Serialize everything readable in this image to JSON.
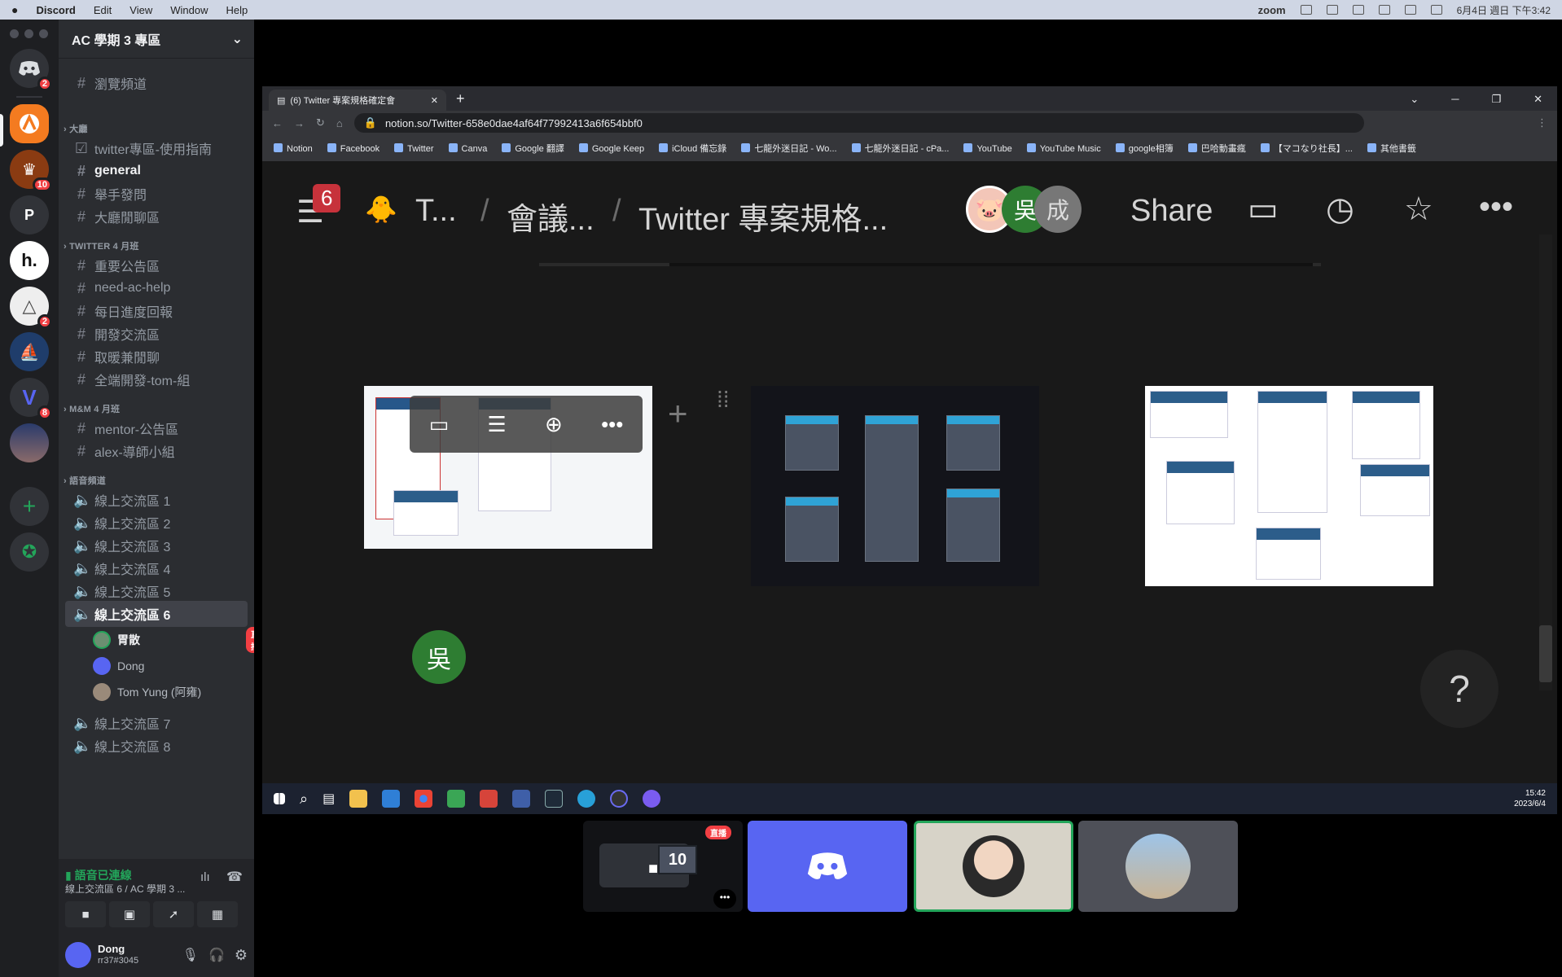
{
  "menubar": {
    "apple": "",
    "app": "Discord",
    "menus": [
      "Edit",
      "View",
      "Window",
      "Help"
    ],
    "zoom": "zoom",
    "clock": "6月4日 週日 下午3:42"
  },
  "rail": {
    "badges": [
      "2",
      "10",
      "2",
      "8"
    ],
    "letters": [
      "P",
      "h."
    ]
  },
  "server": {
    "name": "AC 學期 3 專區",
    "browse": "瀏覽頻道"
  },
  "categories": {
    "lobby": "大廳",
    "twitter": "TWITTER 4 月班",
    "mm": "M&M 4 月班",
    "voice": "語音頻道"
  },
  "channels": {
    "guide": "twitter專區-使用指南",
    "general": "general",
    "ask": "舉手發問",
    "chat": "大廳閒聊區",
    "announce": "重要公告區",
    "help": "need-ac-help",
    "daily": "每日進度回報",
    "dev": "開發交流區",
    "warm": "取暖兼閒聊",
    "fullstack": "全端開發-tom-組",
    "mentor": "mentor-公告區",
    "alex": "alex-導師小組"
  },
  "voice_channels": [
    "線上交流區 1",
    "線上交流區 2",
    "線上交流區 3",
    "線上交流區 4",
    "線上交流區 5",
    "線上交流區 6",
    "線上交流區 7",
    "線上交流區 8"
  ],
  "voice_users": [
    "胃散",
    "Dong",
    "Tom Yung (阿雍)"
  ],
  "live_label": "直播",
  "voice_status": {
    "connected": "語音已連線",
    "location": "線上交流區 6 / AC 學期 3 ..."
  },
  "user": {
    "name": "Dong",
    "tag": "rr37#3045"
  },
  "browser": {
    "tab_title": "(6) Twitter 專案規格確定會",
    "url": "notion.so/Twitter-658e0dae4af64f77992413a6f654bbf0",
    "bookmarks": [
      "Notion",
      "Facebook",
      "Twitter",
      "Canva",
      "Google 翻譯",
      "Google Keep",
      "iCloud 備忘錄",
      "七龍外迷日記 - Wo...",
      "七龍外迷日記 - cPa...",
      "YouTube",
      "YouTube Music",
      "google相簿",
      "巴哈動畫瘋",
      "【マコなり社長】...",
      "其他書籤"
    ]
  },
  "notion": {
    "count": "6",
    "crumb1": "T...",
    "crumb2": "會議...",
    "crumb3": "Twitter 專案規格...",
    "share": "Share",
    "avatar1": "吳",
    "avatar2": "成",
    "cursor_avatar": "吳",
    "help": "?"
  },
  "taskbar": {
    "time": "15:42",
    "date": "2023/6/4"
  },
  "stream_tile": {
    "count": "10",
    "live": "直播"
  }
}
